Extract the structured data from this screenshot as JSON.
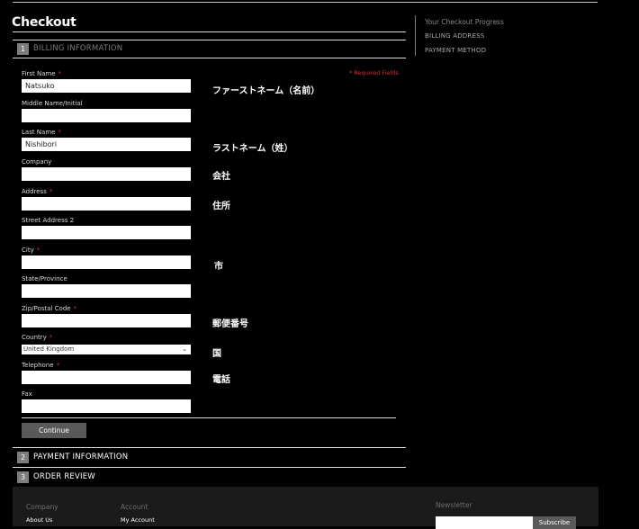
{
  "page": {
    "title": "Checkout"
  },
  "sections": [
    {
      "num": "1",
      "label": "BILLING INFORMATION"
    },
    {
      "num": "2",
      "label": "PAYMENT INFORMATION"
    },
    {
      "num": "3",
      "label": "ORDER REVIEW"
    }
  ],
  "form": {
    "required_note": "* Required Fields",
    "fields": {
      "first_name": {
        "label": "First Name",
        "value": "Natsuko",
        "required": "*"
      },
      "middle_name": {
        "label": "Middle Name/Initial",
        "value": ""
      },
      "last_name": {
        "label": "Last Name",
        "value": "Nishibori",
        "required": "*"
      },
      "company": {
        "label": "Company",
        "value": ""
      },
      "address": {
        "label": "Address",
        "value": "",
        "required": "*"
      },
      "street2": {
        "label": "Street Address 2",
        "value": ""
      },
      "city": {
        "label": "City",
        "value": "",
        "required": "*"
      },
      "state": {
        "label": "State/Province",
        "value": ""
      },
      "zip": {
        "label": "Zip/Postal Code",
        "value": "",
        "required": "*"
      },
      "country": {
        "label": "Country",
        "value": "United Kingdom",
        "required": "*"
      },
      "telephone": {
        "label": "Telephone",
        "value": "",
        "required": "*"
      },
      "fax": {
        "label": "Fax",
        "value": ""
      }
    },
    "continue_label": "Continue"
  },
  "annotations": {
    "first_name": "ファーストネーム（名前）",
    "last_name": "ラストネーム（姓）",
    "company": "会社",
    "address": "住所",
    "city": "市",
    "zip": "郵便番号",
    "country": "国",
    "telephone": "電話"
  },
  "sidebar": {
    "title": "Your Checkout Progress",
    "items": [
      "BILLING ADDRESS",
      "PAYMENT METHOD"
    ]
  },
  "footer": {
    "company_heading": "Company",
    "company_link": "About Us",
    "account_heading": "Account",
    "account_link": "My Account",
    "newsletter_heading": "Newsletter",
    "subscribe_label": "Subscribe"
  },
  "icons": {
    "dropdown": "chevron-down-icon"
  },
  "colors": {
    "required": "#d93030",
    "background": "#000000",
    "section_badge": "#7d7d7d"
  }
}
